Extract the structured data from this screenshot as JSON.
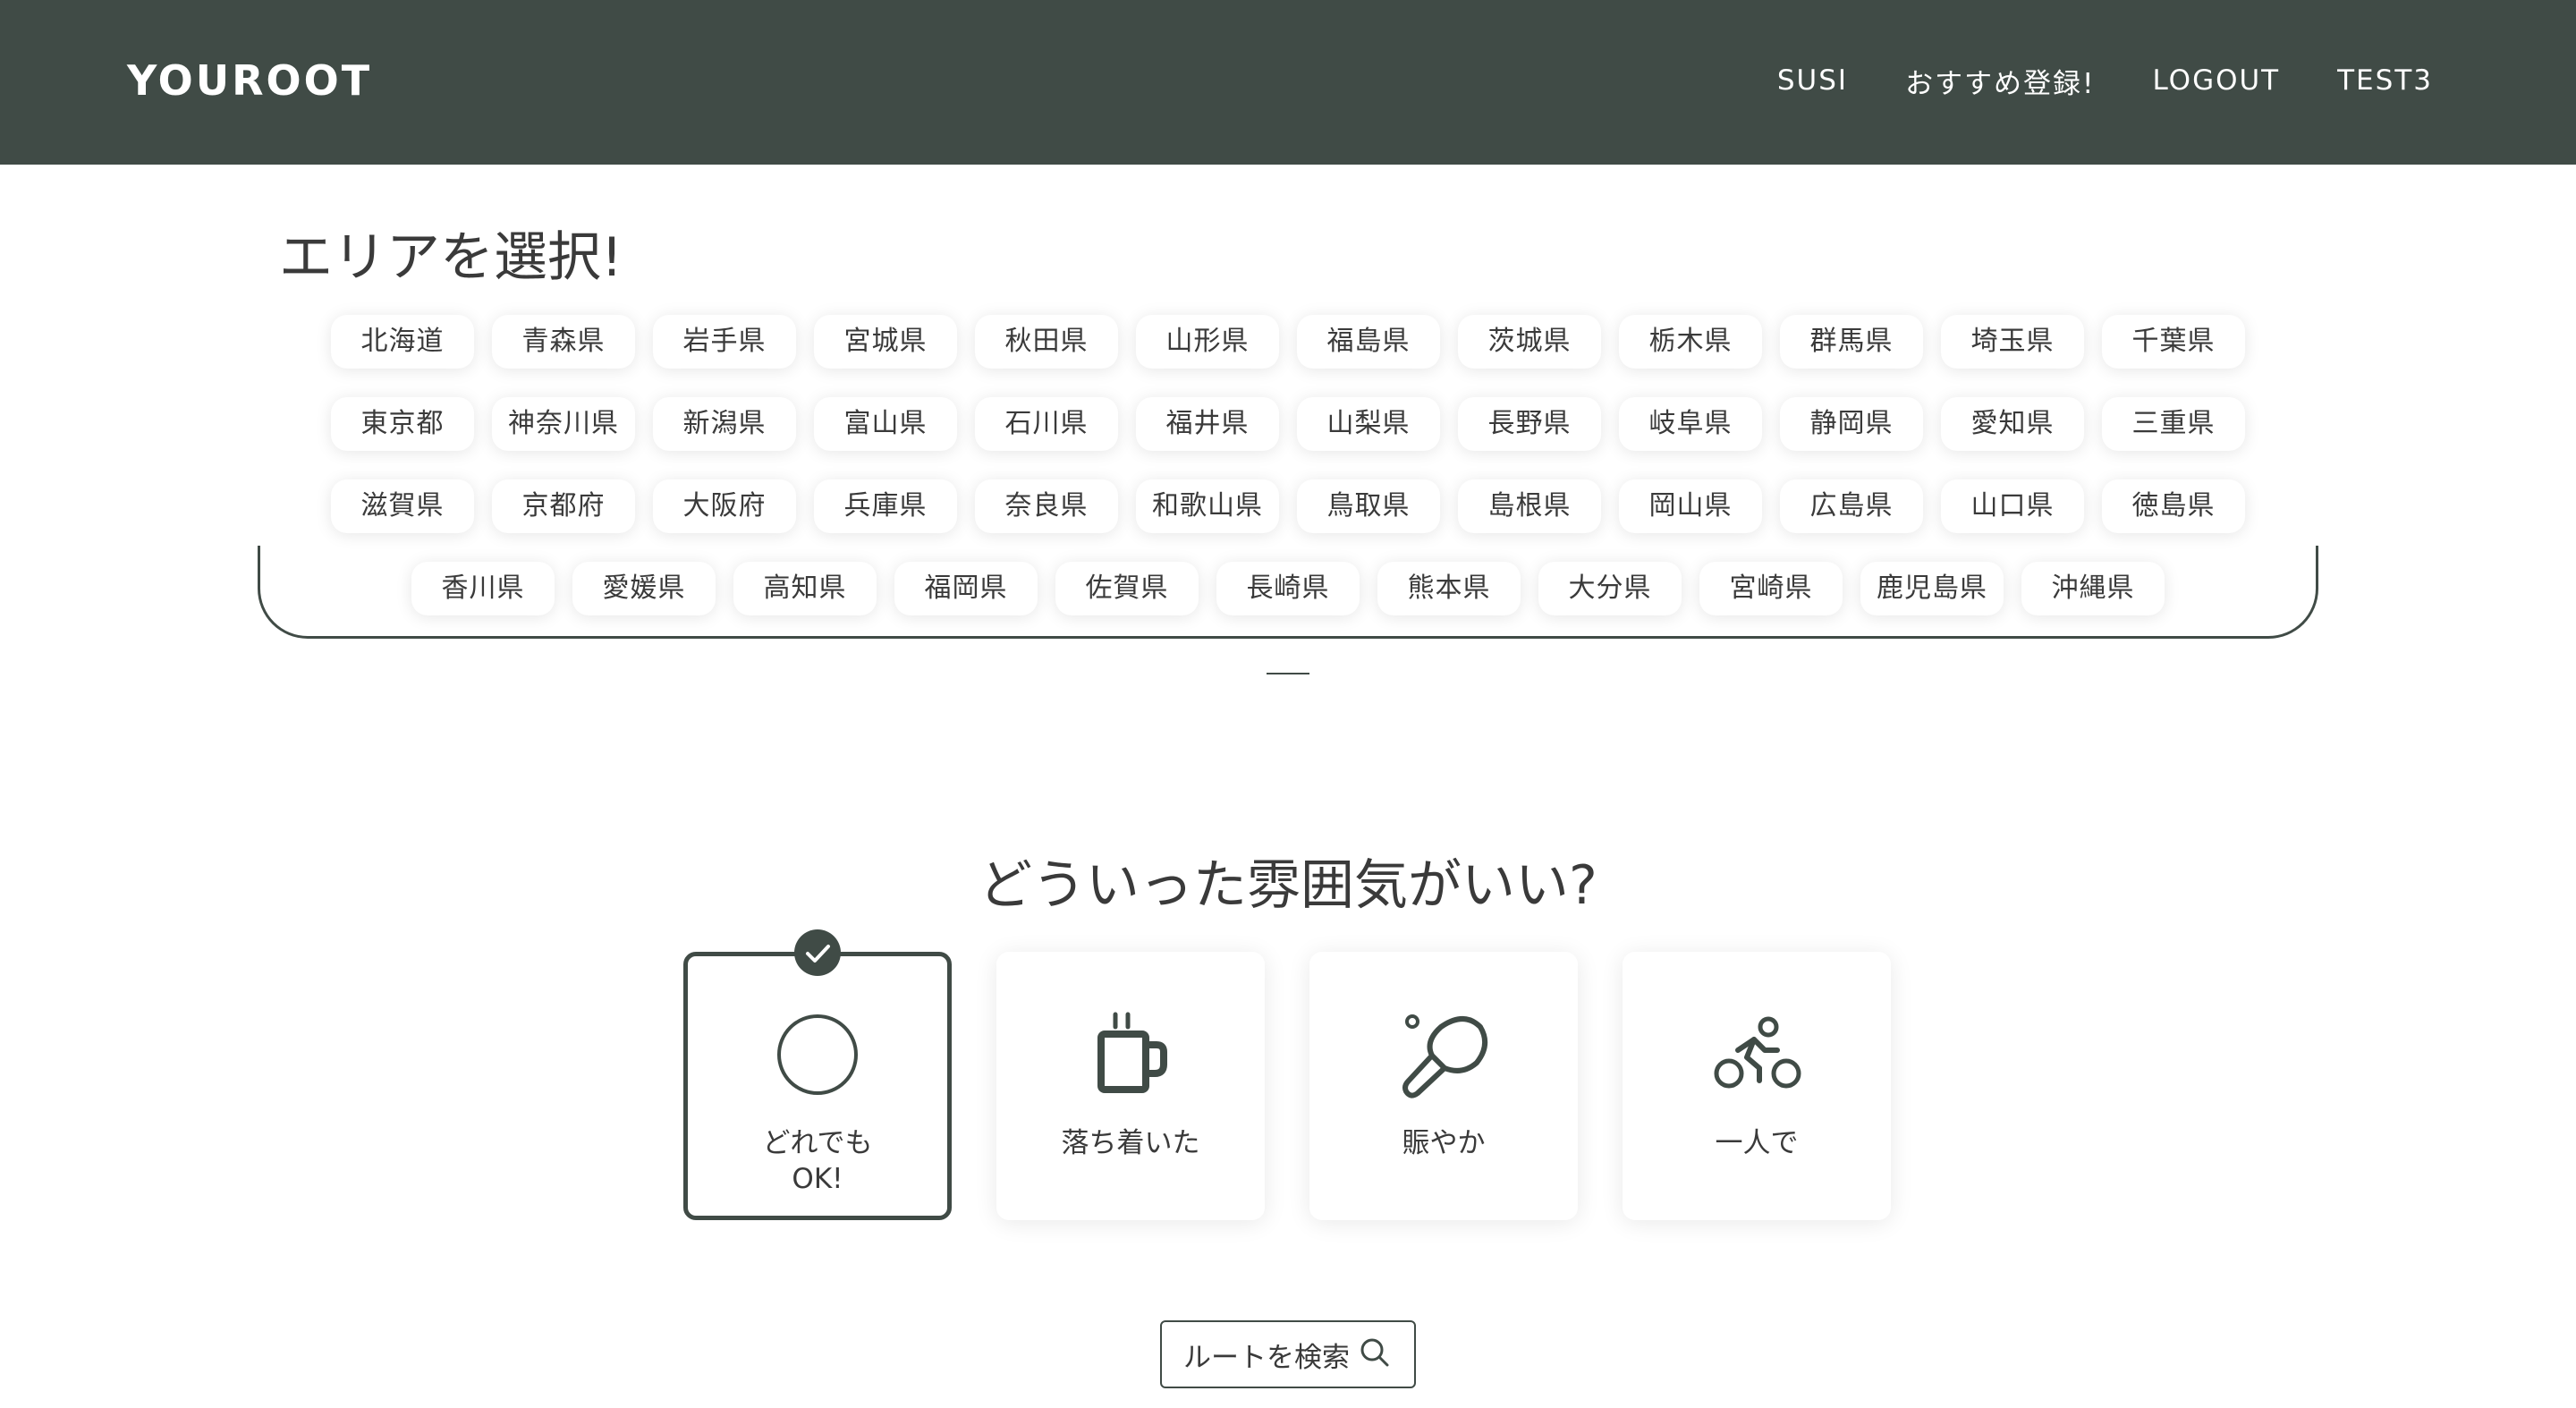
{
  "header": {
    "logo": "YOUROOT",
    "nav": [
      {
        "label": "SUSI"
      },
      {
        "label": "おすすめ登録!"
      },
      {
        "label": "LOGOUT"
      },
      {
        "label": "TEST3"
      }
    ],
    "background_color": "#404b46"
  },
  "area": {
    "title": "エリアを選択!",
    "rows": [
      [
        "北海道",
        "青森県",
        "岩手県",
        "宮城県",
        "秋田県",
        "山形県",
        "福島県",
        "茨城県",
        "栃木県",
        "群馬県",
        "埼玉県",
        "千葉県"
      ],
      [
        "東京都",
        "神奈川県",
        "新潟県",
        "富山県",
        "石川県",
        "福井県",
        "山梨県",
        "長野県",
        "岐阜県",
        "静岡県",
        "愛知県",
        "三重県"
      ],
      [
        "滋賀県",
        "京都府",
        "大阪府",
        "兵庫県",
        "奈良県",
        "和歌山県",
        "鳥取県",
        "島根県",
        "岡山県",
        "広島県",
        "山口県",
        "徳島県"
      ],
      [
        "香川県",
        "愛媛県",
        "高知県",
        "福岡県",
        "佐賀県",
        "長崎県",
        "熊本県",
        "大分県",
        "宮崎県",
        "鹿児島県",
        "沖縄県"
      ]
    ]
  },
  "mood": {
    "title": "どういった雰囲気がいい?",
    "options": [
      {
        "label": "どれでも\nOK!",
        "icon": "circle-icon",
        "selected": true
      },
      {
        "label": "落ち着いた",
        "icon": "coffee-mug-icon",
        "selected": false
      },
      {
        "label": "賑やか",
        "icon": "ping-pong-icon",
        "selected": false
      },
      {
        "label": "一人で",
        "icon": "cyclist-icon",
        "selected": false
      }
    ]
  },
  "search_button": {
    "label": "ルートを検索",
    "icon": "search-icon"
  },
  "accent_color": "#404b46"
}
